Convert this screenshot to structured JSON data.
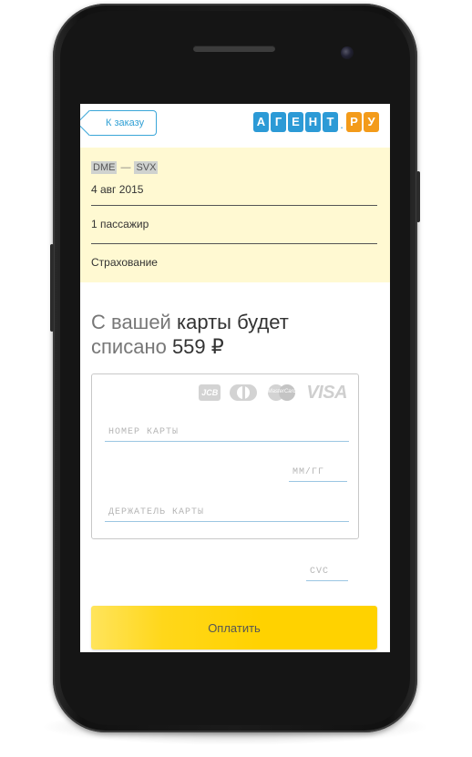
{
  "header": {
    "back_label": "К заказу",
    "logo_letters": [
      "А",
      "Г",
      "Е",
      "Н",
      "Т"
    ],
    "logo_dot": ".",
    "logo_suffix": [
      "Р",
      "У"
    ]
  },
  "summary": {
    "origin": "DME",
    "separator": "—",
    "destination": "SVX",
    "date": "4 авг 2015",
    "passengers": "1 пассажир",
    "insurance": "Страхование"
  },
  "payment": {
    "title_part1": "С вашей ",
    "title_part2": "карты будет",
    "title_part3": "списано ",
    "amount": "559 ₽",
    "brands": [
      "JCB",
      "Diners Club",
      "MasterCard",
      "VISA"
    ],
    "card_number_placeholder": "НОМЕР КАРТЫ",
    "expiry_placeholder": "ММ/ГГ",
    "holder_placeholder": "ДЕРЖАТЕЛЬ КАРТЫ",
    "cvc_placeholder": "CVC",
    "pay_label": "Оплатить"
  },
  "colors": {
    "accent_blue": "#2c9ad6",
    "accent_orange": "#f39b1a",
    "summary_bg": "#fff9d2",
    "pay_button": "#ffd200"
  }
}
